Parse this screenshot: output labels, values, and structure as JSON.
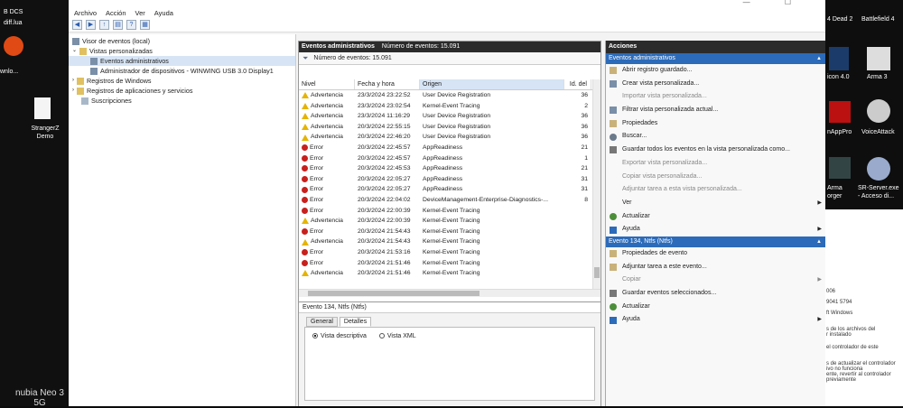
{
  "desktop_left": {
    "items": [
      "B DCS",
      "diff.lua",
      "wnlo...",
      "StrangerZ",
      "Demo"
    ],
    "watermark": "nubia Neo 3 5G"
  },
  "desktop_right": {
    "items": [
      "4 Dead 2",
      "Battlefield 4",
      "icon 4.0",
      "Arma 3",
      "nAppPro",
      "VoiceAttack",
      "Arma",
      "orger",
      "SR-Server.exe",
      "- Acceso di..."
    ],
    "overlay_lines": [
      "006",
      "9041 5794",
      "ft Windows",
      "s de los archivos del",
      "r instalado",
      "el controlador de este",
      "s de actualizar el controlador",
      "ivo no funciona",
      "ente, revertir al controlador",
      "previamente"
    ]
  },
  "window": {
    "menu": [
      "Archivo",
      "Acción",
      "Ver",
      "Ayuda"
    ],
    "tree": [
      {
        "label": "Visor de eventos (local)",
        "indent": 0
      },
      {
        "label": "Vistas personalizadas",
        "indent": 1
      },
      {
        "label": "Eventos administrativos",
        "indent": 2,
        "selected": true
      },
      {
        "label": "Administrador de dispositivos - WINWING USB 3.0 Display1",
        "indent": 2
      },
      {
        "label": "Registros de Windows",
        "indent": 1
      },
      {
        "label": "Registros de aplicaciones y servicios",
        "indent": 1
      },
      {
        "label": "Suscripciones",
        "indent": 1
      }
    ],
    "center": {
      "header_title": "Eventos administrativos",
      "header_count": "Número de eventos: 15.091",
      "filter_text": "Número de eventos: 15.091",
      "columns": [
        "Nivel",
        "Fecha y hora",
        "Origen",
        "Id. del"
      ],
      "rows": [
        {
          "level": "Advertencia",
          "type": "warn",
          "date": "23/3/2024 23:22:52",
          "source": "User Device Registration",
          "id": "36"
        },
        {
          "level": "Advertencia",
          "type": "warn",
          "date": "23/3/2024 23:02:54",
          "source": "Kernel-Event Tracing",
          "id": "2"
        },
        {
          "level": "Advertencia",
          "type": "warn",
          "date": "23/3/2024 11:16:29",
          "source": "User Device Registration",
          "id": "36"
        },
        {
          "level": "Advertencia",
          "type": "warn",
          "date": "20/3/2024 22:55:15",
          "source": "User Device Registration",
          "id": "36"
        },
        {
          "level": "Advertencia",
          "type": "warn",
          "date": "20/3/2024 22:46:20",
          "source": "User Device Registration",
          "id": "36"
        },
        {
          "level": "Error",
          "type": "err",
          "date": "20/3/2024 22:45:57",
          "source": "AppReadiness",
          "id": "21"
        },
        {
          "level": "Error",
          "type": "err",
          "date": "20/3/2024 22:45:57",
          "source": "AppReadiness",
          "id": "1"
        },
        {
          "level": "Error",
          "type": "err",
          "date": "20/3/2024 22:45:53",
          "source": "AppReadiness",
          "id": "21"
        },
        {
          "level": "Error",
          "type": "err",
          "date": "20/3/2024 22:05:27",
          "source": "AppReadiness",
          "id": "31"
        },
        {
          "level": "Error",
          "type": "err",
          "date": "20/3/2024 22:05:27",
          "source": "AppReadiness",
          "id": "31"
        },
        {
          "level": "Error",
          "type": "err",
          "date": "20/3/2024 22:04:02",
          "source": "DeviceManagement-Enterprise-Diagnostics-...",
          "id": "8"
        },
        {
          "level": "Error",
          "type": "err",
          "date": "20/3/2024 22:00:39",
          "source": "Kernel-Event Tracing",
          "id": ""
        },
        {
          "level": "Advertencia",
          "type": "warn",
          "date": "20/3/2024 22:00:39",
          "source": "Kernel-Event Tracing",
          "id": ""
        },
        {
          "level": "Error",
          "type": "err",
          "date": "20/3/2024 21:54:43",
          "source": "Kernel-Event Tracing",
          "id": ""
        },
        {
          "level": "Advertencia",
          "type": "warn",
          "date": "20/3/2024 21:54:43",
          "source": "Kernel-Event Tracing",
          "id": ""
        },
        {
          "level": "Error",
          "type": "err",
          "date": "20/3/2024 21:53:16",
          "source": "Kernel-Event Tracing",
          "id": ""
        },
        {
          "level": "Error",
          "type": "err",
          "date": "20/3/2024 21:51:46",
          "source": "Kernel-Event Tracing",
          "id": ""
        },
        {
          "level": "Advertencia",
          "type": "warn",
          "date": "20/3/2024 21:51:46",
          "source": "Kernel-Event Tracing",
          "id": ""
        }
      ],
      "detail_title": "Evento 134, Ntfs (Ntfs)",
      "detail_tabs": [
        "General",
        "Detalles"
      ],
      "detail_active_tab": "Detalles",
      "radio_1": "Vista descriptiva",
      "radio_2": "Vista XML"
    },
    "actions": {
      "header": "Acciones",
      "section1": "Eventos administrativos",
      "items1": [
        {
          "label": "Abrir registro guardado...",
          "icon": "folder-icon",
          "cls": "ai-p"
        },
        {
          "label": "Crear vista personalizada...",
          "icon": "filter-icon",
          "cls": "ai-f"
        },
        {
          "label": "Importar vista personalizada...",
          "icon": "import-icon",
          "cls": "",
          "disabled": true
        },
        {
          "label": "Filtrar vista personalizada actual...",
          "icon": "filter-icon",
          "cls": "ai-f"
        },
        {
          "label": "Propiedades",
          "icon": "properties-icon",
          "cls": "ai-p"
        },
        {
          "label": "Buscar...",
          "icon": "binoculars-icon",
          "cls": "ai-b"
        },
        {
          "label": "Guardar todos los eventos en la vista personalizada como...",
          "icon": "save-icon",
          "cls": "ai-s"
        },
        {
          "label": "Exportar vista personalizada...",
          "icon": "export-icon",
          "cls": "",
          "disabled": true
        },
        {
          "label": "Copiar vista personalizada...",
          "icon": "copy-icon",
          "cls": "",
          "disabled": true
        },
        {
          "label": "Adjuntar tarea a esta vista personalizada...",
          "icon": "task-icon",
          "cls": "",
          "disabled": true
        },
        {
          "label": "Ver",
          "icon": "view-icon",
          "cls": "",
          "submenu": true
        },
        {
          "label": "Actualizar",
          "icon": "refresh-icon",
          "cls": "ai-g"
        },
        {
          "label": "Ayuda",
          "icon": "help-icon",
          "cls": "ai-h",
          "submenu": true
        }
      ],
      "section2": "Evento 134, Ntfs (Ntfs)",
      "items2": [
        {
          "label": "Propiedades de evento",
          "icon": "properties-icon",
          "cls": "ai-p"
        },
        {
          "label": "Adjuntar tarea a este evento...",
          "icon": "task-icon",
          "cls": "ai-p"
        },
        {
          "label": "Copiar",
          "icon": "copy-icon",
          "cls": "",
          "submenu": true,
          "disabled": true
        },
        {
          "label": "Guardar eventos seleccionados...",
          "icon": "save-icon",
          "cls": "ai-s"
        },
        {
          "label": "Actualizar",
          "icon": "refresh-icon",
          "cls": "ai-g"
        },
        {
          "label": "Ayuda",
          "icon": "help-icon",
          "cls": "ai-h",
          "submenu": true
        }
      ]
    }
  }
}
